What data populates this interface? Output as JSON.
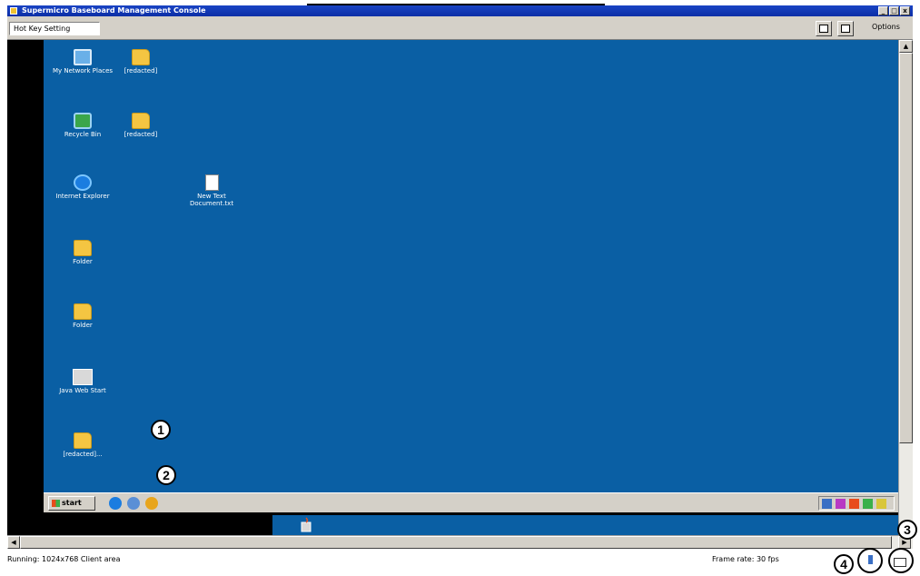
{
  "window": {
    "title": "Supermicro Baseboard Management Console"
  },
  "toolbar": {
    "dropdown_value": "Hot Key Setting",
    "options_label": "Options"
  },
  "desktop": {
    "icons": [
      {
        "label": "My Network Places"
      },
      {
        "label": "[redacted]"
      },
      {
        "label": "Recycle Bin"
      },
      {
        "label": "[redacted]"
      },
      {
        "label": "Internet Explorer"
      },
      {
        "label": "New Text Document.txt"
      },
      {
        "label": "Folder"
      },
      {
        "label": "Folder"
      },
      {
        "label": "Java Web Start"
      },
      {
        "label": "[redacted]..."
      }
    ],
    "taskbar": {
      "start_label": "start"
    }
  },
  "status": {
    "left_text": "Running: 1024x768 Client area",
    "right_text": "Frame rate: 30 fps"
  },
  "callouts": [
    "1",
    "2",
    "3",
    "4"
  ],
  "icon_names": [
    "computer-icon",
    "folder-icon",
    "recycle-bin-icon",
    "internet-explorer-icon",
    "text-document-icon",
    "java-icon",
    "keyboard-icon",
    "mouse-icon",
    "cursor-icon"
  ]
}
